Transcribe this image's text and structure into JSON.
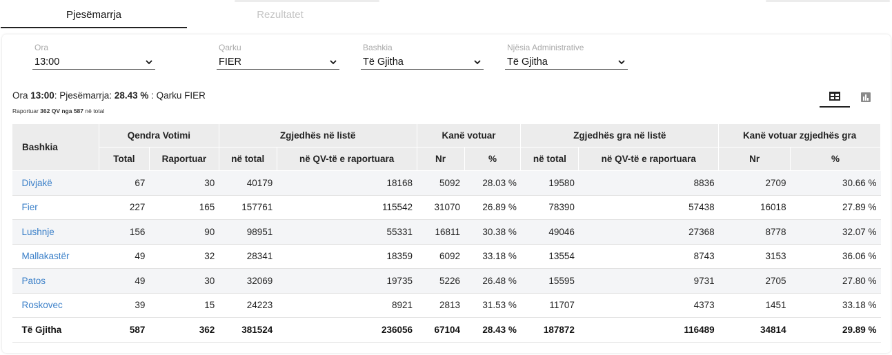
{
  "tabs": [
    {
      "label": "Pjesëmarrja"
    },
    {
      "label": "Rezultatet"
    }
  ],
  "filters": {
    "ora": {
      "label": "Ora",
      "value": "13:00"
    },
    "qarku": {
      "label": "Qarku",
      "value": "FIER"
    },
    "bashkia": {
      "label": "Bashkia",
      "value": "Të Gjitha"
    },
    "njesia": {
      "label": "Njësia Administrative",
      "value": "Të Gjitha"
    }
  },
  "summary": {
    "ora_prefix": "Ora ",
    "ora_value": "13:00",
    "participation_prefix": ": Pjesëmarrja: ",
    "participation_value": "28.43 %",
    "qarku_text": " : Qarku FIER",
    "reported_prefix": "Raportuar ",
    "reported_value": "362 QV nga 587",
    "reported_suffix": " në total"
  },
  "view_toggle": {
    "table_icon": "table-icon",
    "chart_icon": "bar-chart-icon",
    "active": "table"
  },
  "table": {
    "header_row1": {
      "bashkia": "Bashkia",
      "qendra": "Qendra Votimi",
      "zgjedhes": "Zgjedhës në listë",
      "votuar": "Kanë votuar",
      "gra": "Zgjedhës gra në listë",
      "gra_votuar": "Kanë votuar zgjedhës gra"
    },
    "header_row2": [
      "Total",
      "Raportuar",
      "në total",
      "në QV-të e raportuara",
      "Nr",
      "%",
      "në total",
      "në QV-të e raportuara",
      "Nr",
      "%"
    ],
    "rows": [
      {
        "name": "Divjakë",
        "cells": [
          "67",
          "30",
          "40179",
          "18168",
          "5092",
          "28.03 %",
          "19580",
          "8836",
          "2709",
          "30.66 %"
        ]
      },
      {
        "name": "Fier",
        "cells": [
          "227",
          "165",
          "157761",
          "115542",
          "31070",
          "26.89 %",
          "78390",
          "57438",
          "16018",
          "27.89 %"
        ]
      },
      {
        "name": "Lushnje",
        "cells": [
          "156",
          "90",
          "98951",
          "55331",
          "16811",
          "30.38 %",
          "49046",
          "27368",
          "8778",
          "32.07 %"
        ]
      },
      {
        "name": "Mallakastër",
        "cells": [
          "49",
          "32",
          "28341",
          "18359",
          "6092",
          "33.18 %",
          "13554",
          "8743",
          "3153",
          "36.06 %"
        ]
      },
      {
        "name": "Patos",
        "cells": [
          "49",
          "30",
          "32069",
          "19735",
          "5226",
          "26.48 %",
          "15595",
          "9731",
          "2705",
          "27.80 %"
        ]
      },
      {
        "name": "Roskovec",
        "cells": [
          "39",
          "15",
          "24223",
          "8921",
          "2813",
          "31.53 %",
          "11707",
          "4373",
          "1451",
          "33.18 %"
        ]
      }
    ],
    "total": {
      "name": "Të Gjitha",
      "cells": [
        "587",
        "362",
        "381524",
        "236056",
        "67104",
        "28.43 %",
        "187872",
        "116489",
        "34814",
        "29.89 %"
      ]
    }
  }
}
